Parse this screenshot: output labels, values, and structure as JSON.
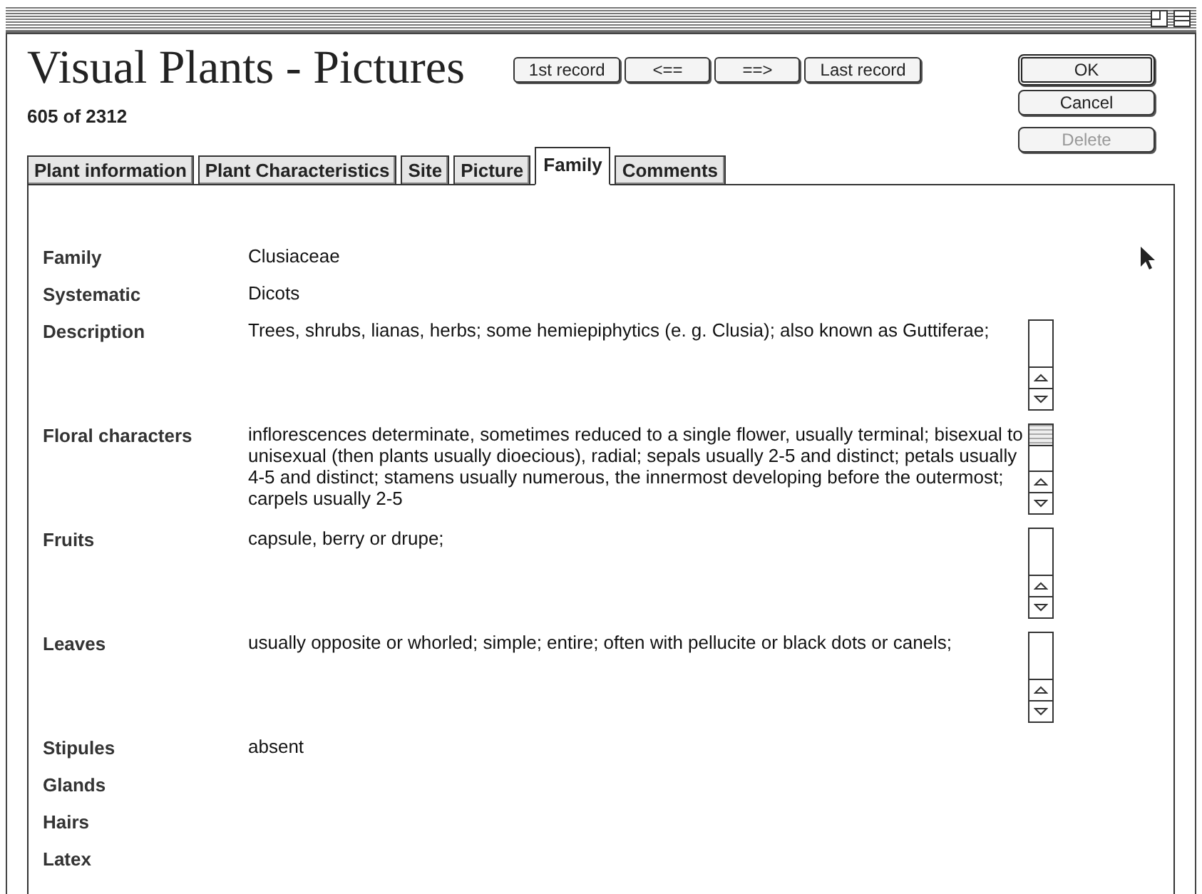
{
  "window": {
    "title": "Visual Plants - Pictures"
  },
  "record_counter": "605 of 2312",
  "nav_buttons": [
    "1st record",
    "<==",
    "==>",
    "Last record"
  ],
  "action_buttons": [
    {
      "label": "OK",
      "default": true,
      "disabled": false
    },
    {
      "label": "Cancel",
      "default": false,
      "disabled": false
    },
    {
      "label": "Delete",
      "default": false,
      "disabled": true
    }
  ],
  "tabs": [
    {
      "label": "Plant information",
      "selected": false
    },
    {
      "label": "Plant Characteristics",
      "selected": false
    },
    {
      "label": "Site",
      "selected": false
    },
    {
      "label": "Picture",
      "selected": false
    },
    {
      "label": "Family",
      "selected": true
    },
    {
      "label": "Comments",
      "selected": false
    }
  ],
  "fields": [
    {
      "kind": "text",
      "label": "Family",
      "value": "Clusiaceae"
    },
    {
      "kind": "text",
      "label": "Systematic",
      "value": "Dicots"
    },
    {
      "kind": "scroll",
      "label": "Description",
      "value": "Trees, shrubs, lianas, herbs; some hemiepiphytics (e. g. Clusia); also known as Guttiferae;",
      "scrolled": false
    },
    {
      "kind": "scroll",
      "label": "Floral characters",
      "value": "inflorescences determinate, sometimes reduced to a single flower, usually terminal; bisexual to unisexual (then plants usually dioecious), radial; sepals usually 2-5 and distinct; petals usually 4-5 and distinct; stamens usually numerous, the innermost developing before the outermost; carpels usually 2-5",
      "scrolled": true
    },
    {
      "kind": "scroll",
      "label": "Fruits",
      "value": "capsule, berry or drupe;",
      "scrolled": false
    },
    {
      "kind": "scroll",
      "label": "Leaves",
      "value": "usually opposite or whorled; simple; entire; often with pellucite or black dots or canels;",
      "scrolled": false
    },
    {
      "kind": "text",
      "label": "Stipules",
      "value": "absent"
    },
    {
      "kind": "text",
      "label": "Glands"
    },
    {
      "kind": "text",
      "label": "Hairs"
    },
    {
      "kind": "text",
      "label": "Latex"
    }
  ]
}
